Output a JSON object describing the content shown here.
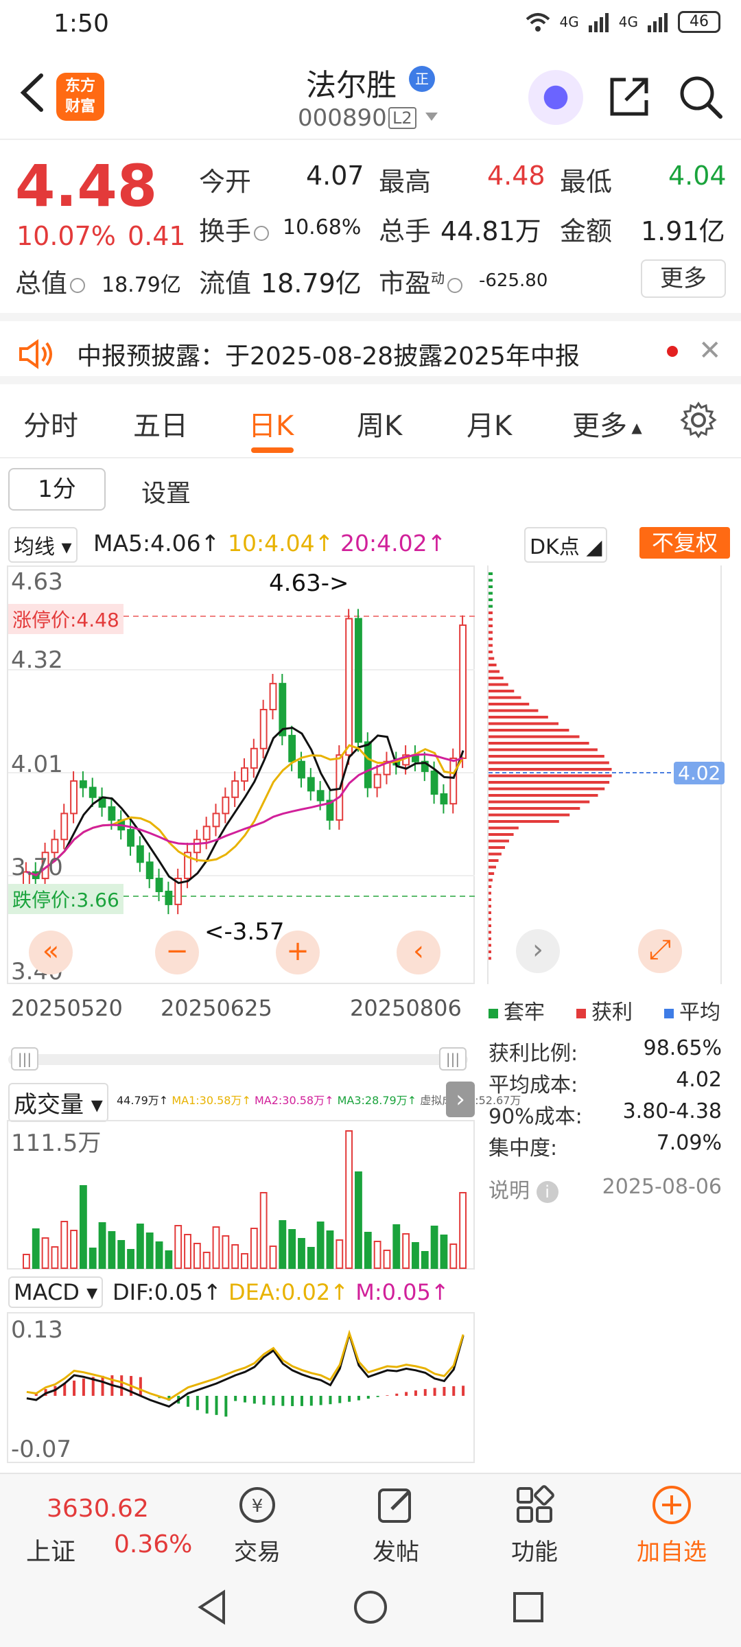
{
  "status": {
    "time": "1:50",
    "net1": "4G",
    "net2": "4G",
    "battery": "46"
  },
  "header": {
    "logo_line1": "东方",
    "logo_line2": "财富",
    "name": "法尔胜",
    "badge": "正",
    "code": "000890",
    "level": "L2"
  },
  "quote": {
    "price": "4.48",
    "pct": "10.07%",
    "change": "0.41",
    "open_label": "今开",
    "open": "4.07",
    "high_label": "最高",
    "high": "4.48",
    "low_label": "最低",
    "low": "4.04",
    "turnover_label": "换手",
    "turnover": "10.68%",
    "volume_label": "总手",
    "volume": "44.81万",
    "amount_label": "金额",
    "amount": "1.91亿",
    "mcap_label": "总值",
    "mcap": "18.79亿",
    "float_label": "流值",
    "float": "18.79亿",
    "pe_label": "市盈",
    "pe_sup": "动",
    "pe": "-625.80",
    "more": "更多"
  },
  "notice": {
    "text": "中报预披露：于2025-08-28披露2025年中报"
  },
  "tabs": [
    "分时",
    "五日",
    "日K",
    "周K",
    "月K",
    "更多"
  ],
  "subtabs": [
    "1分",
    "设置"
  ],
  "ma_bar": {
    "type": "均线",
    "ma5": "MA5:4.06",
    "ma10": "10:4.04",
    "ma20": "20:4.02",
    "dk": "DK点",
    "fuquan": "不复权"
  },
  "kline": {
    "price_top": "4.63",
    "price_2": "4.32",
    "price_3": "4.01",
    "price_4": "3.70",
    "price_bottom": "3.40",
    "limit_up": "涨停价:4.48",
    "limit_down": "跌停价:3.66",
    "high_marker": "4.63->",
    "low_marker": "<-3.57",
    "dates": [
      "20250520",
      "20250625",
      "20250806"
    ]
  },
  "chip": {
    "avg_tag": "4.02",
    "legend": [
      "套牢",
      "获利",
      "平均"
    ],
    "rows": [
      {
        "label": "获利比例:",
        "value": "98.65%"
      },
      {
        "label": "平均成本:",
        "value": "4.02"
      },
      {
        "label": "90%成本:",
        "value": "3.80-4.38"
      },
      {
        "label": "集中度:",
        "value": "7.09%"
      }
    ],
    "note_label": "说明",
    "note_date": "2025-08-06"
  },
  "volume": {
    "title": "成交量",
    "stats": "44.79万↑",
    "ma1": "MA1:30.58万↑",
    "ma2": "MA2:30.58万↑",
    "ma3": "MA3:28.79万↑",
    "virtual": "虚拟成交量:52.67万",
    "top": "111.5万"
  },
  "macd": {
    "title": "MACD",
    "dif": "DIF:0.05↑",
    "dea": "DEA:0.02↑",
    "m": "M:0.05↑",
    "top": "0.13",
    "bottom": "-0.07"
  },
  "bottom": {
    "index_value": "3630.62",
    "index_name": "上证",
    "index_pct": "0.36%",
    "items": [
      "交易",
      "发帖",
      "功能",
      "加自选"
    ]
  },
  "colors": {
    "up": "#e33a3a",
    "down": "#1aa33c",
    "accent": "#ff6a13"
  },
  "chart_data": {
    "type": "candlestick",
    "date_labels": [
      "20250520",
      "20250625",
      "20250806"
    ],
    "closes": [
      3.72,
      3.7,
      3.78,
      3.82,
      3.9,
      4.0,
      3.98,
      3.95,
      3.92,
      3.88,
      3.85,
      3.8,
      3.75,
      3.7,
      3.66,
      3.62,
      3.7,
      3.78,
      3.82,
      3.86,
      3.9,
      3.95,
      4.0,
      4.04,
      4.1,
      4.22,
      4.3,
      4.14,
      4.06,
      4.01,
      3.97,
      3.94,
      3.88,
      4.08,
      4.5,
      4.12,
      3.98,
      4.02,
      4.06,
      4.05,
      4.08,
      4.06,
      4.03,
      3.96,
      3.93,
      4.07,
      4.48
    ],
    "ma5_last": 4.06,
    "ma10_last": 4.04,
    "ma20_last": 4.02,
    "ylim": [
      3.4,
      4.63
    ],
    "limit_up": 4.48,
    "limit_down": 3.66
  }
}
